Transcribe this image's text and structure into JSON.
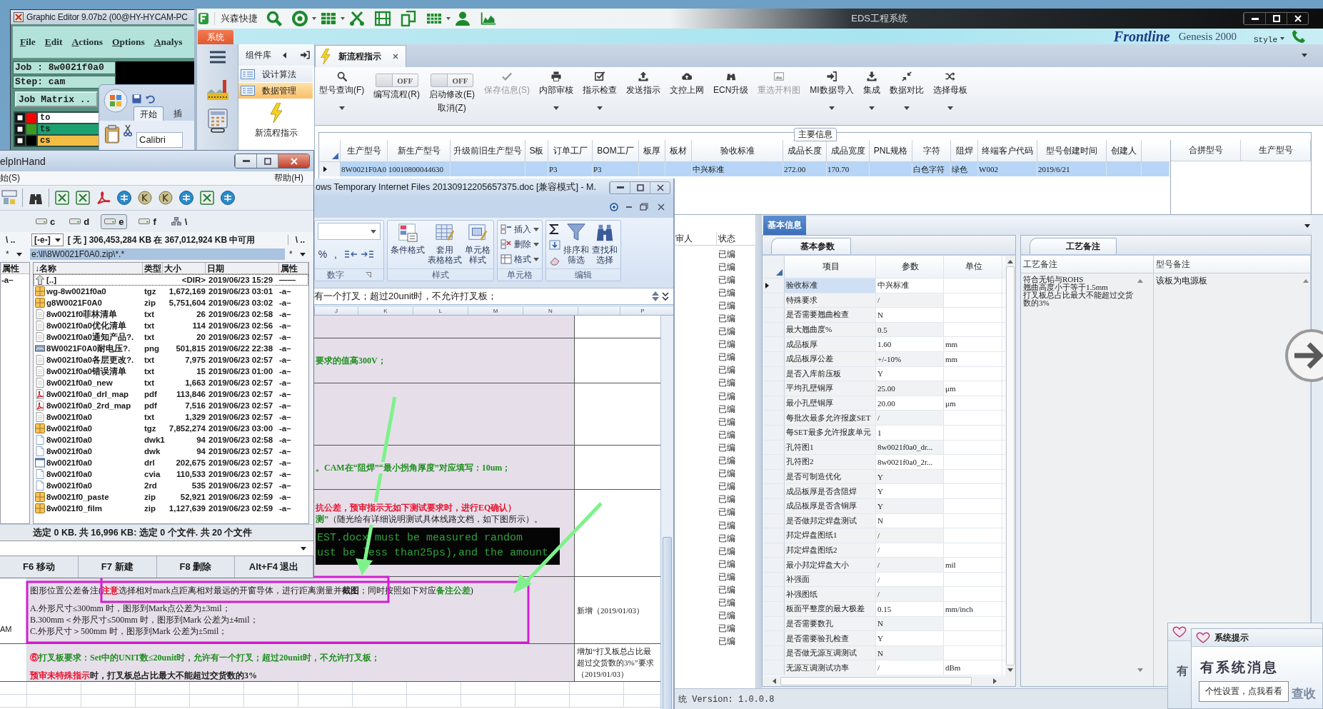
{
  "graphic_editor": {
    "title": "Graphic Editor 9.07b2 (00@HY-HYCAM-PC",
    "menu": [
      "File",
      "Edit",
      "Actions",
      "Options",
      "Analys"
    ],
    "job": "Job : 8w0021f0a0",
    "step": "Step: cam",
    "matrix_button": "Job Matrix ..",
    "layers": [
      {
        "name": "to",
        "color": "#ff0000",
        "kind": "silkscreen"
      },
      {
        "name": "ts",
        "color": "#3c9a1e",
        "kind": "soldermask"
      },
      {
        "name": "cs",
        "color": "#000000",
        "kind": "signal"
      }
    ]
  },
  "excel_back": {
    "tabs": [
      {
        "label": "开始",
        "selected": true
      },
      {
        "label": "插",
        "selected": false
      }
    ],
    "font": "Calibri"
  },
  "eds": {
    "title": "EDS工程系统",
    "app_name": "兴森快捷",
    "system_tab": "系统",
    "banner": {
      "logo": "Frontline",
      "product": "Genesis 2000",
      "style_menu": "Style"
    },
    "sidebar": {
      "title": "组件库",
      "items": [
        {
          "label": "设计算法",
          "selected": false
        },
        {
          "label": "数据管理",
          "selected": true
        }
      ],
      "tool": "新流程指示"
    },
    "doc_tab": "新流程指示",
    "toolbar": [
      {
        "kind": "button",
        "label": "型号查询(F)",
        "disabled": false,
        "dropdown": true
      },
      {
        "kind": "toggle",
        "label": "编写流程(R)",
        "switch_text": "OFF",
        "on": false
      },
      {
        "kind": "toggle",
        "label": "启动修改(E)",
        "second_label": "取消(Z)",
        "switch_text": "OFF",
        "on": false
      },
      {
        "kind": "button",
        "label": "保存信息(S)",
        "disabled": true,
        "dropdown": false
      },
      {
        "kind": "button",
        "label": "内部审核",
        "disabled": false,
        "dropdown": true
      },
      {
        "kind": "button",
        "label": "指示检查",
        "disabled": false,
        "dropdown": true
      },
      {
        "kind": "button",
        "label": "发送指示",
        "disabled": false,
        "dropdown": false
      },
      {
        "kind": "button",
        "label": "文控上网",
        "disabled": false,
        "dropdown": false
      },
      {
        "kind": "button",
        "label": "ECN升级",
        "disabled": false,
        "dropdown": false
      },
      {
        "kind": "button",
        "label": "重选开料图",
        "disabled": true,
        "dropdown": false
      },
      {
        "kind": "button",
        "label": "MI数据导入",
        "disabled": false,
        "dropdown": true
      },
      {
        "kind": "button",
        "label": "集成",
        "disabled": false,
        "dropdown": true
      },
      {
        "kind": "button",
        "label": "数据对比",
        "disabled": false,
        "dropdown": true
      },
      {
        "kind": "button",
        "label": "选择母板",
        "disabled": false,
        "dropdown": true
      }
    ],
    "main_info": {
      "title": "主要信息",
      "columns": [
        "生产型号",
        "新生产型号",
        "升级前旧生产型号",
        "S板",
        "订单工厂",
        "BOM工厂",
        "板厚",
        "板材",
        "验收标准",
        "成品长度",
        "成品宽度",
        "PNL规格",
        "字符",
        "阻焊",
        "终端客户代码",
        "型号创建时间",
        "创建人"
      ],
      "rows": [
        {
          "selected": true,
          "cells": [
            "8W0021F0A0",
            "10010800044630",
            null,
            null,
            "P3",
            "P3",
            null,
            null,
            "中兴标准",
            "272.00",
            "170.70",
            null,
            "白色字符",
            "绿色",
            "W002",
            "2019/6/21",
            null
          ]
        }
      ],
      "merge_columns": [
        "合拼型号",
        "生产型号"
      ]
    },
    "review_list": {
      "columns": [
        "审人",
        "状态"
      ],
      "rows": [
        "已编",
        "已编",
        "已编",
        "已编",
        "已编",
        "已编",
        "已编",
        "已编",
        "已编",
        "已编",
        "已编",
        "已编",
        "已编",
        "已编",
        "已编",
        "已编",
        "已编",
        "已编",
        "已编",
        "已编",
        "已编",
        "已编",
        "已编",
        "已编",
        "已编",
        "已编",
        "已编",
        "已编",
        "已编",
        "已编",
        "已编"
      ]
    },
    "basic_info": {
      "tab": "基本信息",
      "params": {
        "tab": "基本参数",
        "columns": [
          "项目",
          "参数",
          "单位"
        ],
        "rows": [
          {
            "item": "验收标准",
            "value": "中兴标准",
            "selected": true
          },
          {
            "item": "特殊要求",
            "value": "/",
            "selected": false
          },
          {
            "item": "是否需要翘曲检查",
            "value": "N",
            "selected": false
          },
          {
            "item": "最大翘曲度%",
            "value": "0.5",
            "selected": false
          },
          {
            "item": "成品板厚",
            "value": "1.60",
            "unit": "mm",
            "selected": false
          },
          {
            "item": "成品板厚公差",
            "value": "+/-10%",
            "unit": "mm",
            "selected": false
          },
          {
            "item": "是否入库前压板",
            "value": "Y",
            "selected": false
          },
          {
            "item": "平均孔壁铜厚",
            "value": "25.00",
            "unit": "μm",
            "selected": false
          },
          {
            "item": "最小孔壁铜厚",
            "value": "20.00",
            "unit": "μm",
            "selected": false
          },
          {
            "item": "每批次最多允许报废SET",
            "value": "/",
            "selected": false
          },
          {
            "item": "每SET最多允许报废单元",
            "value": "1",
            "selected": false
          },
          {
            "item": "孔符图1",
            "value": "8w0021f0a0_dr...",
            "selected": false
          },
          {
            "item": "孔符图2",
            "value": "8w0021f0a0_2r...",
            "selected": false
          },
          {
            "item": "是否可制造优化",
            "value": "Y",
            "selected": false
          },
          {
            "item": "成品板厚是否含阻焊",
            "value": "Y",
            "selected": false
          },
          {
            "item": "成品板厚是否含铜厚",
            "value": "Y",
            "selected": false
          },
          {
            "item": "是否做邦定焊盘测试",
            "value": "N",
            "selected": false
          },
          {
            "item": "邦定焊盘图纸1",
            "value": "/",
            "selected": false
          },
          {
            "item": "邦定焊盘图纸2",
            "value": "/",
            "selected": false
          },
          {
            "item": "最小邦定焊盘大小",
            "value": "/",
            "unit": "mil",
            "selected": false
          },
          {
            "item": "补强面",
            "value": "/",
            "selected": false
          },
          {
            "item": "补强图纸",
            "value": "/",
            "selected": false
          },
          {
            "item": "板面平整度的最大极差",
            "value": "0.15",
            "unit": "mm/inch",
            "selected": false
          },
          {
            "item": "是否需要数孔",
            "value": "N",
            "selected": false
          },
          {
            "item": "是否需要验孔检查",
            "value": "Y",
            "selected": false
          },
          {
            "item": "是否做无源互调测试",
            "value": "N",
            "selected": false
          },
          {
            "item": "无源互调测试功率",
            "value": "/",
            "unit": "dBm",
            "selected": false
          }
        ]
      },
      "notes": {
        "tab": "工艺备注",
        "columns": [
          "工艺备注",
          "型号备注"
        ],
        "process_note": [
          "符合无铅与ROHS",
          "翘曲高度小于等于1.5mm",
          "打叉板总占比最大不能超过交货数的3%"
        ],
        "model_note": "该板为电源板"
      }
    },
    "status": "统 Version: 1.0.0.8"
  },
  "excel_doc": {
    "title": "ows Temporary Internet Files 20130912205657375.doc [兼容模式] - M.",
    "ribbon": {
      "number": {
        "label": "数字",
        "buttons": [
          "%",
          ","
        ]
      },
      "styles": {
        "label": "样式",
        "buttons": [
          {
            "label": "条件格式"
          },
          {
            "label": "套用",
            "second_label": "表格格式"
          },
          {
            "label": "单元格",
            "second_label": "样式"
          }
        ]
      },
      "cells": {
        "label": "单元格",
        "buttons": [
          "插入",
          "删除",
          "格式"
        ]
      },
      "editing": {
        "label": "编辑",
        "buttons": [
          {
            "label": "排序和",
            "second_label": "筛选"
          },
          {
            "label": "查找和",
            "second_label": "选择"
          }
        ]
      }
    },
    "formula": "有一个打叉；超过20unit时，不允许打叉板；",
    "columns": [
      "J",
      "K",
      "L",
      "M",
      "N",
      "P"
    ],
    "rows": [
      {
        "kind": "empty"
      },
      {
        "kind": "text",
        "lines": [
          [
            {
              "kind": "highlight",
              "text": "要求的值高300V；"
            }
          ]
        ]
      },
      {
        "kind": "empty"
      },
      {
        "kind": "text",
        "lines": [
          [
            {
              "kind": "highlight",
              "text": "。CAM在“阻焊”“最小拐角厚度”对应填写：10um；"
            }
          ]
        ]
      },
      {
        "kind": "text",
        "lines": [
          [
            {
              "kind": "alert",
              "text": "抗公差，预审指示无如下测试要求时，进行EQ确认）"
            }
          ],
          [
            {
              "kind": "highlight",
              "text": "测”"
            },
            {
              "kind": "normal",
              "text": "（随光绘有详细说明测试具体线路文档，如下图所示）。"
            }
          ]
        ],
        "image_lines": [
          "EST.docx must be measured random",
          "ust be less than25ps),and the amount"
        ]
      },
      {
        "kind": "full",
        "left_cell": "AM",
        "lines": [
          [
            {
              "kind": "normal",
              "text": "图形位置公差备注("
            },
            {
              "kind": "alert",
              "text": "注意"
            },
            {
              "kind": "normal",
              "text": "选择相对mark点距离相对最远的开窗导体，进行距离测量并"
            },
            {
              "kind": "strong",
              "text": "截图"
            },
            {
              "kind": "normal",
              "text": "；同时按照如下对应"
            },
            {
              "kind": "highlight",
              "text": "备注公差"
            },
            {
              "kind": "normal",
              "text": ")"
            }
          ],
          [
            {
              "kind": "normal",
              "text": "A.外形尺寸≤300mm 时，图形到Mark点公差为±3mil；"
            }
          ],
          [
            {
              "kind": "normal",
              "text": "B.300mm＜外形尺寸≤500mm 时，图形到Mark 公差为±4mil；"
            }
          ],
          [
            {
              "kind": "normal",
              "text": "C.外形尺寸＞500mm 时，图形到Mark 公差为±5mil；"
            }
          ]
        ],
        "note_lines": [
          "新增（2019/01/03）"
        ]
      },
      {
        "kind": "full",
        "lines": [
          [
            {
              "kind": "alert",
              "text": "⑥"
            },
            {
              "kind": "highlight",
              "text": "打叉板要求：Set中的UNIT数≤20unit时，允许有一个打叉；超过20unit时，不允许打叉板；"
            }
          ],
          [
            {
              "kind": "alert",
              "text": "预审未特殊指示"
            },
            {
              "kind": "strong",
              "text": "时，打叉板总占比最大不能超过交货数的3%"
            }
          ]
        ],
        "note_lines": [
          "增加“打叉板总占比最",
          "超过交货数的3%”要求",
          "（2019/01/03）"
        ]
      }
    ]
  },
  "file_manager": {
    "title": "elpInHand",
    "menu": [
      "始(S)",
      "帮助(H)"
    ],
    "drives": [
      {
        "kind": "drive",
        "label": "c",
        "selected": false
      },
      {
        "kind": "drive",
        "label": "d",
        "selected": false
      },
      {
        "kind": "drive",
        "label": "e",
        "selected": true
      },
      {
        "kind": "drive",
        "label": "f",
        "selected": false
      },
      {
        "kind": "network",
        "label": "\\",
        "selected": false
      }
    ],
    "left_nav": "\\ ..",
    "drive_select": "[-e-]",
    "free_space": "[ 无 ] 306,453,284 KB 在 367,012,924 KB 中可用",
    "right_nav": "\\ ..",
    "left_filter": "*",
    "path": "e:\\ll\\8W0021F0A0.zip\\*.*",
    "right_filter": "*",
    "left_pane": {
      "column": "属性",
      "rows": [
        "-a–"
      ]
    },
    "columns": [
      "↓名称",
      "类型",
      "大小",
      "日期",
      "属性"
    ],
    "rows": [
      {
        "kind": "up",
        "name": "[..]",
        "size": "<DIR>",
        "date": "2019/06/23 15:29",
        "attr": "——",
        "selected": true
      },
      {
        "kind": "archive",
        "name": "wg-8w0021f0a0",
        "type": "tgz",
        "size": "1,672,169",
        "date": "2019/06/23 03:01",
        "attr": "-a–",
        "selected": false
      },
      {
        "kind": "archive",
        "name": "g8W0021F0A0",
        "type": "zip",
        "size": "5,751,604",
        "date": "2019/06/23 03:02",
        "attr": "-a–",
        "selected": false
      },
      {
        "kind": "text",
        "name": "8w0021f0菲林清单",
        "type": "txt",
        "size": "26",
        "date": "2019/06/23 02:58",
        "attr": "-a–",
        "selected": false
      },
      {
        "kind": "text",
        "name": "8w0021f0a0优化清单",
        "type": "txt",
        "size": "114",
        "date": "2019/06/23 02:56",
        "attr": "-a–",
        "selected": false
      },
      {
        "kind": "text",
        "name": "8w0021f0a0通知产品?.",
        "type": "txt",
        "size": "20",
        "date": "2019/06/23 02:57",
        "attr": "-a–",
        "selected": false
      },
      {
        "kind": "image",
        "name": "8W0021F0A0耐电压?.",
        "type": "png",
        "size": "501,815",
        "date": "2019/06/22 22:38",
        "attr": "-a–",
        "selected": false
      },
      {
        "kind": "text",
        "name": "8w0021f0a0各层更改?.",
        "type": "txt",
        "size": "7,975",
        "date": "2019/06/23 02:57",
        "attr": "-a–",
        "selected": false
      },
      {
        "kind": "text",
        "name": "8w0021f0a0错误清单",
        "type": "txt",
        "size": "15",
        "date": "2019/06/23 01:00",
        "attr": "-a–",
        "selected": false
      },
      {
        "kind": "text",
        "name": "8w0021f0a0_new",
        "type": "txt",
        "size": "1,663",
        "date": "2019/06/23 02:57",
        "attr": "-a–",
        "selected": false
      },
      {
        "kind": "pdf",
        "name": "8w0021f0a0_drl_map",
        "type": "pdf",
        "size": "113,846",
        "date": "2019/06/23 02:57",
        "attr": "-a–",
        "selected": false
      },
      {
        "kind": "pdf",
        "name": "8w0021f0a0_2rd_map",
        "type": "pdf",
        "size": "7,516",
        "date": "2019/06/23 02:57",
        "attr": "-a–",
        "selected": false
      },
      {
        "kind": "text",
        "name": "8w0021f0a0",
        "type": "txt",
        "size": "1,329",
        "date": "2019/06/23 02:57",
        "attr": "-a–",
        "selected": false
      },
      {
        "kind": "archive",
        "name": "8w0021f0a0",
        "type": "tgz",
        "size": "7,852,274",
        "date": "2019/06/23 03:00",
        "attr": "-a–",
        "selected": false
      },
      {
        "kind": "file",
        "name": "8w0021f0a0",
        "type": "dwk1",
        "size": "94",
        "date": "2019/06/23 02:58",
        "attr": "-a–",
        "selected": false
      },
      {
        "kind": "file",
        "name": "8w0021f0a0",
        "type": "dwk",
        "size": "94",
        "date": "2019/06/23 02:57",
        "attr": "-a–",
        "selected": false
      },
      {
        "kind": "window",
        "name": "8w0021f0a0",
        "type": "drl",
        "size": "202,675",
        "date": "2019/06/23 02:57",
        "attr": "-a–",
        "selected": false
      },
      {
        "kind": "file",
        "name": "8w0021f0a0",
        "type": "cvia",
        "size": "110,533",
        "date": "2019/06/23 02:57",
        "attr": "-a–",
        "selected": false
      },
      {
        "kind": "file",
        "name": "8w0021f0a0",
        "type": "2rd",
        "size": "535",
        "date": "2019/06/23 02:57",
        "attr": "-a–",
        "selected": false
      },
      {
        "kind": "archive",
        "name": "8w0021f0_paste",
        "type": "zip",
        "size": "52,921",
        "date": "2019/06/23 02:59",
        "attr": "-a–",
        "selected": false
      },
      {
        "kind": "archive",
        "name": "8w0021f0_film",
        "type": "zip",
        "size": "1,127,639",
        "date": "2019/06/23 02:59",
        "attr": "-a–",
        "selected": false
      }
    ],
    "status": "选定 0 KB. 共 16,996 KB: 选定 0 个文件. 共 20 个文件",
    "function_keys": [
      "F6 移动",
      "F7 新建",
      "F8 删除",
      "Alt+F4 退出"
    ]
  },
  "notification": {
    "back_text": "有",
    "title": "系统提示",
    "message": "有系统消息",
    "tooltip": "个性设置，点我看看",
    "link_text": "查收"
  }
}
